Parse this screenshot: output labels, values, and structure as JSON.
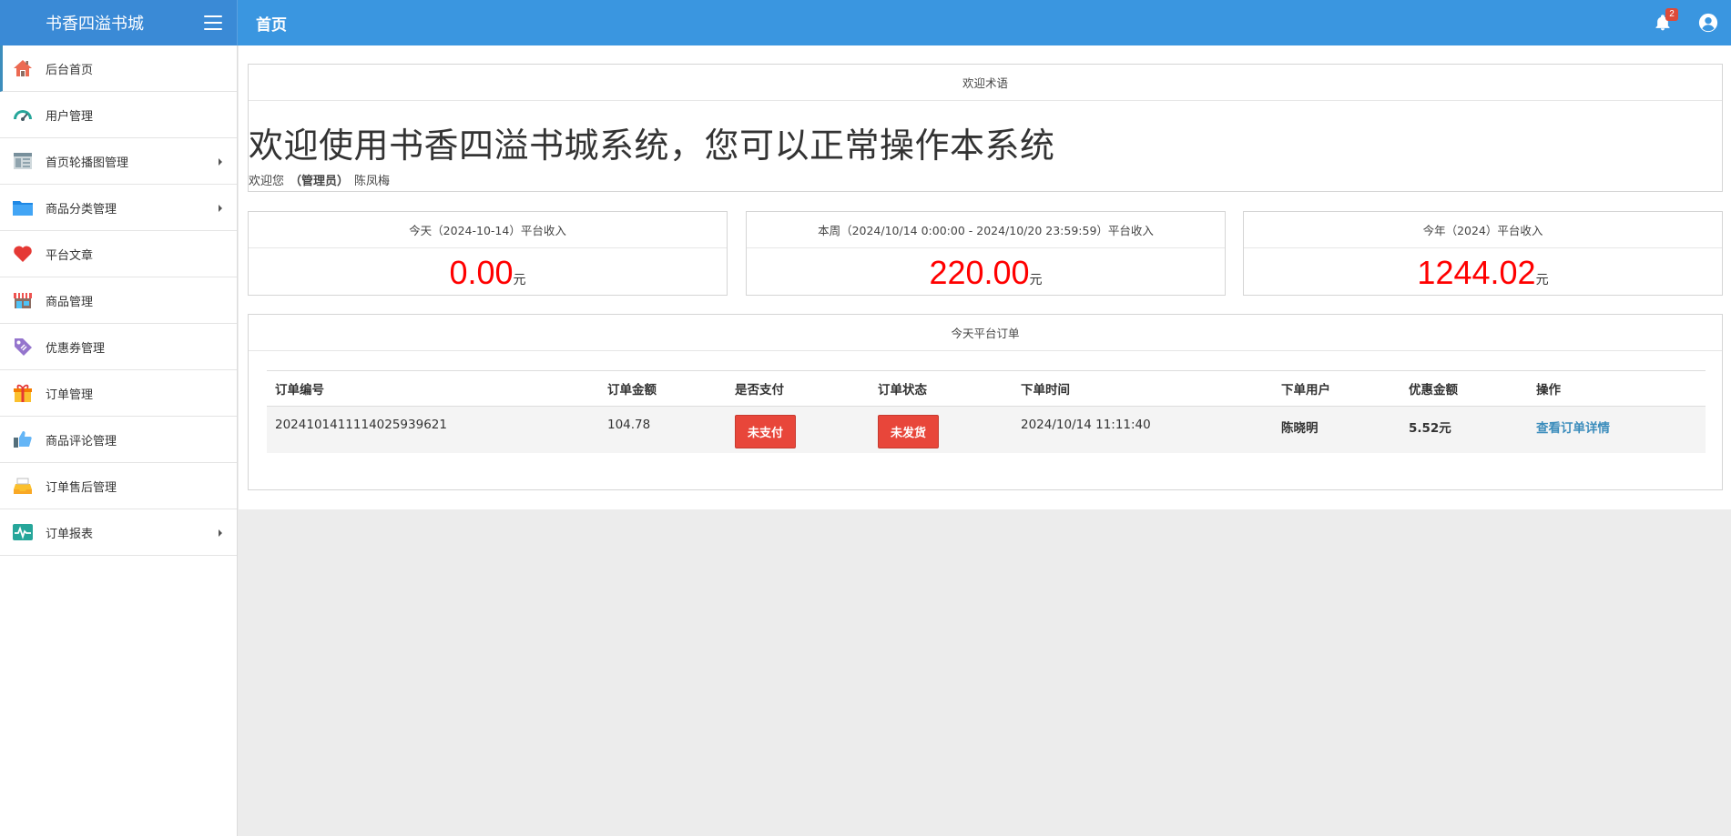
{
  "app": {
    "brand": "书香四溢书城",
    "page_title": "首页"
  },
  "header": {
    "notification_count": "2"
  },
  "sidebar": {
    "items": [
      {
        "label": "后台首页",
        "icon": "home-icon",
        "has_children": false,
        "active": true
      },
      {
        "label": "用户管理",
        "icon": "dashboard-gauge-icon",
        "has_children": false
      },
      {
        "label": "首页轮播图管理",
        "icon": "layout-panel-icon",
        "has_children": true
      },
      {
        "label": "商品分类管理",
        "icon": "folder-icon",
        "has_children": true
      },
      {
        "label": "平台文章",
        "icon": "heart-icon",
        "has_children": false
      },
      {
        "label": "商品管理",
        "icon": "store-icon",
        "has_children": false
      },
      {
        "label": "优惠券管理",
        "icon": "tag-icon",
        "has_children": false
      },
      {
        "label": "订单管理",
        "icon": "gift-icon",
        "has_children": false
      },
      {
        "label": "商品评论管理",
        "icon": "thumbs-up-icon",
        "has_children": false
      },
      {
        "label": "订单售后管理",
        "icon": "inbox-tray-icon",
        "has_children": false
      },
      {
        "label": "订单报表",
        "icon": "pulse-chart-icon",
        "has_children": true
      }
    ]
  },
  "welcome": {
    "header": "欢迎术语",
    "big_text": "欢迎使用书香四溢书城系统，您可以正常操作本系统",
    "sub_prefix": "欢迎您",
    "role": "（管理员）",
    "user_name": "陈凤梅"
  },
  "stats": {
    "today": {
      "label": "今天（2024-10-14）平台收入",
      "value": "0.00",
      "unit": "元"
    },
    "week": {
      "label": "本周（2024/10/14 0:00:00 - 2024/10/20 23:59:59）平台收入",
      "value": "220.00",
      "unit": "元"
    },
    "year": {
      "label": "今年（2024）平台收入",
      "value": "1244.02",
      "unit": "元"
    }
  },
  "orders": {
    "header": "今天平台订单",
    "columns": [
      "订单编号",
      "订单金额",
      "是否支付",
      "订单状态",
      "下单时间",
      "下单用户",
      "优惠金额",
      "操作"
    ],
    "rows": [
      {
        "order_no": "2024101411114025939621",
        "amount": "104.78",
        "paid": "未支付",
        "status": "未发货",
        "time": "2024/10/14 11:11:40",
        "user": "陈晓明",
        "discount": "5.52元",
        "action": "查看订单详情"
      }
    ]
  },
  "colors": {
    "topbar": "#3a96e0",
    "accent": "#3c8dbc",
    "danger": "#e8463a",
    "stat_value": "#ff0000"
  }
}
